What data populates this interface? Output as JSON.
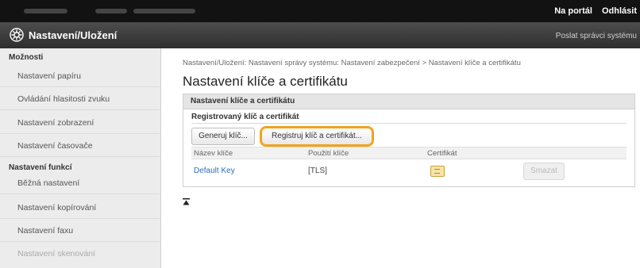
{
  "header": {
    "portal_link": "Na portál",
    "logout_link": "Odhlásit"
  },
  "titlebar": {
    "title": "Nastavení/Uložení",
    "sysadmin_link": "Poslat správci systému"
  },
  "sidebar": {
    "section1": "Možnosti",
    "items1": [
      "Nastavení papíru",
      "Ovládání hlasitosti zvuku",
      "Nastavení zobrazení",
      "Nastavení časovače"
    ],
    "section2": "Nastavení funkcí",
    "items2": [
      "Běžná nastavení",
      "Nastavení kopírování",
      "Nastavení faxu",
      "Nastavení skenování"
    ]
  },
  "main": {
    "breadcrumb": "Nastavení/Uložení: Nastavení správy systému: Nastavení zabezpečení > Nastavení klíče a certifikátu",
    "page_title": "Nastavení klíče a certifikátu",
    "panel_title": "Nastavení klíče a certifikátu",
    "sub_label": "Registrovaný klíč a certifikát",
    "buttons": {
      "generate": "Generuj klíč...",
      "register": "Registruj klíč a certifikát...",
      "delete": "Smazat"
    },
    "table": {
      "headers": [
        "Název klíče",
        "Použití klíče",
        "Certifikát"
      ],
      "rows": [
        {
          "key_name": "Default Key",
          "key_usage": "[TLS]"
        }
      ]
    }
  },
  "icons": {
    "gear": "gear-icon",
    "certificate": "certificate-icon",
    "page_top": "page-top-icon"
  },
  "colors": {
    "highlight": "#f2a21b",
    "link": "#2a6ebb",
    "topbar": "#121212",
    "titlebar": "#3a3a3a"
  }
}
